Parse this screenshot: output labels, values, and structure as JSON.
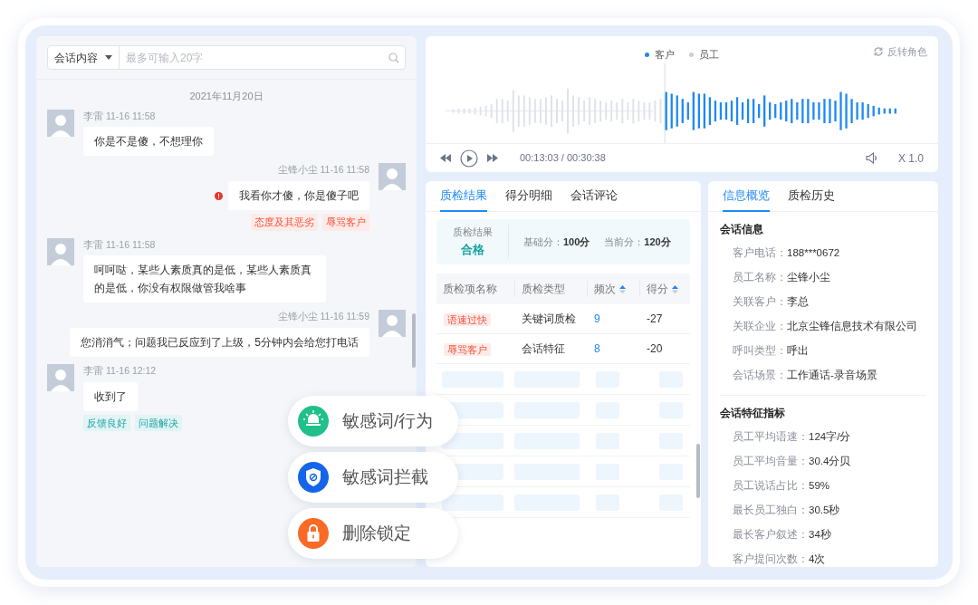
{
  "chat": {
    "search": {
      "scope": "会话内容",
      "placeholder": "最多可输入20字"
    },
    "date": "2021年11月20日",
    "messages": [
      {
        "kind": "customer",
        "meta": "李雷 11-16 11:58",
        "text": "你是不是傻，不想理你",
        "alert": false
      },
      {
        "kind": "employee",
        "meta": "尘锋小尘 11-16 11:58",
        "text": "我看你才傻，你是傻子吧",
        "alert": true,
        "tags": [
          {
            "label": "态度及其恶劣",
            "kind": "negative"
          },
          {
            "label": "辱骂客户",
            "kind": "negative"
          }
        ]
      },
      {
        "kind": "customer",
        "meta": "李雷 11-16 11:58",
        "text": "呵呵哒，某些人素质真的是低，某些人素质真的是低，你没有权限做管我啥事",
        "alert": false
      },
      {
        "kind": "employee",
        "meta": "尘锋小尘 11-16 11:59",
        "text": "您消消气；问题我已反应到了上级，5分钟内会给您打电话",
        "alert": false
      },
      {
        "kind": "customer",
        "meta": "李雷 11-16 12:12",
        "text": "收到了",
        "alert": false,
        "tags": [
          {
            "label": "反馈良好",
            "kind": "positive"
          },
          {
            "label": "问题解决",
            "kind": "positive"
          }
        ]
      }
    ]
  },
  "player": {
    "legend": [
      {
        "label": "客户",
        "color": "#1e88f5"
      },
      {
        "label": "员工",
        "color": "#c9ced8"
      }
    ],
    "flip": "反转角色",
    "time": "00:13:03 / 00:30:38",
    "speed": "X 1.0"
  },
  "result_panel": {
    "tabs": [
      {
        "label": "质检结果",
        "selected": true
      },
      {
        "label": "得分明细",
        "selected": false
      },
      {
        "label": "会话评论",
        "selected": false
      }
    ],
    "summary": {
      "label": "质检结果",
      "verdict": "合格",
      "base_label": "基础分：",
      "base": "100分",
      "current_label": "当前分：",
      "current": "120分"
    },
    "columns": [
      {
        "label": "质检项名称",
        "sortable": false
      },
      {
        "label": "质检类型",
        "sortable": false
      },
      {
        "label": "频次",
        "sortable": true
      },
      {
        "label": "得分",
        "sortable": true
      }
    ],
    "rows": [
      {
        "name": "语速过快",
        "type": "关键词质检",
        "count": "9",
        "score": "-27"
      },
      {
        "name": "辱骂客户",
        "type": "会话特征",
        "count": "8",
        "score": "-20"
      }
    ]
  },
  "info_panel": {
    "tabs": [
      {
        "label": "信息概览",
        "selected": true
      },
      {
        "label": "质检历史",
        "selected": false
      }
    ],
    "sections": [
      {
        "title": "会话信息",
        "fields": [
          {
            "label": "客户电话：",
            "value": "188***0672"
          },
          {
            "label": "员工名称：",
            "value": "尘锋小尘"
          },
          {
            "label": "关联客户：",
            "value": "李总"
          },
          {
            "label": "关联企业：",
            "value": "北京尘锋信息技术有限公司"
          },
          {
            "label": "呼叫类型：",
            "value": "呼出"
          },
          {
            "label": "会话场景：",
            "value": "工作通话-录音场景"
          }
        ]
      },
      {
        "title": "会话特征指标",
        "fields": [
          {
            "label": "员工平均语速：",
            "value": "124字/分"
          },
          {
            "label": "员工平均音量：",
            "value": "30.4分贝"
          },
          {
            "label": "员工说话占比：",
            "value": "59%"
          },
          {
            "label": "最长员工独白：",
            "value": "30.5秒"
          },
          {
            "label": "最长客户叙述：",
            "value": "34秒"
          },
          {
            "label": "客户提问次数：",
            "value": "4次"
          }
        ]
      }
    ]
  },
  "features": [
    {
      "kind": "alarm",
      "label": "敏感词/行为"
    },
    {
      "kind": "shield",
      "label": "敏感词拦截"
    },
    {
      "kind": "lock",
      "label": "删除锁定"
    }
  ]
}
